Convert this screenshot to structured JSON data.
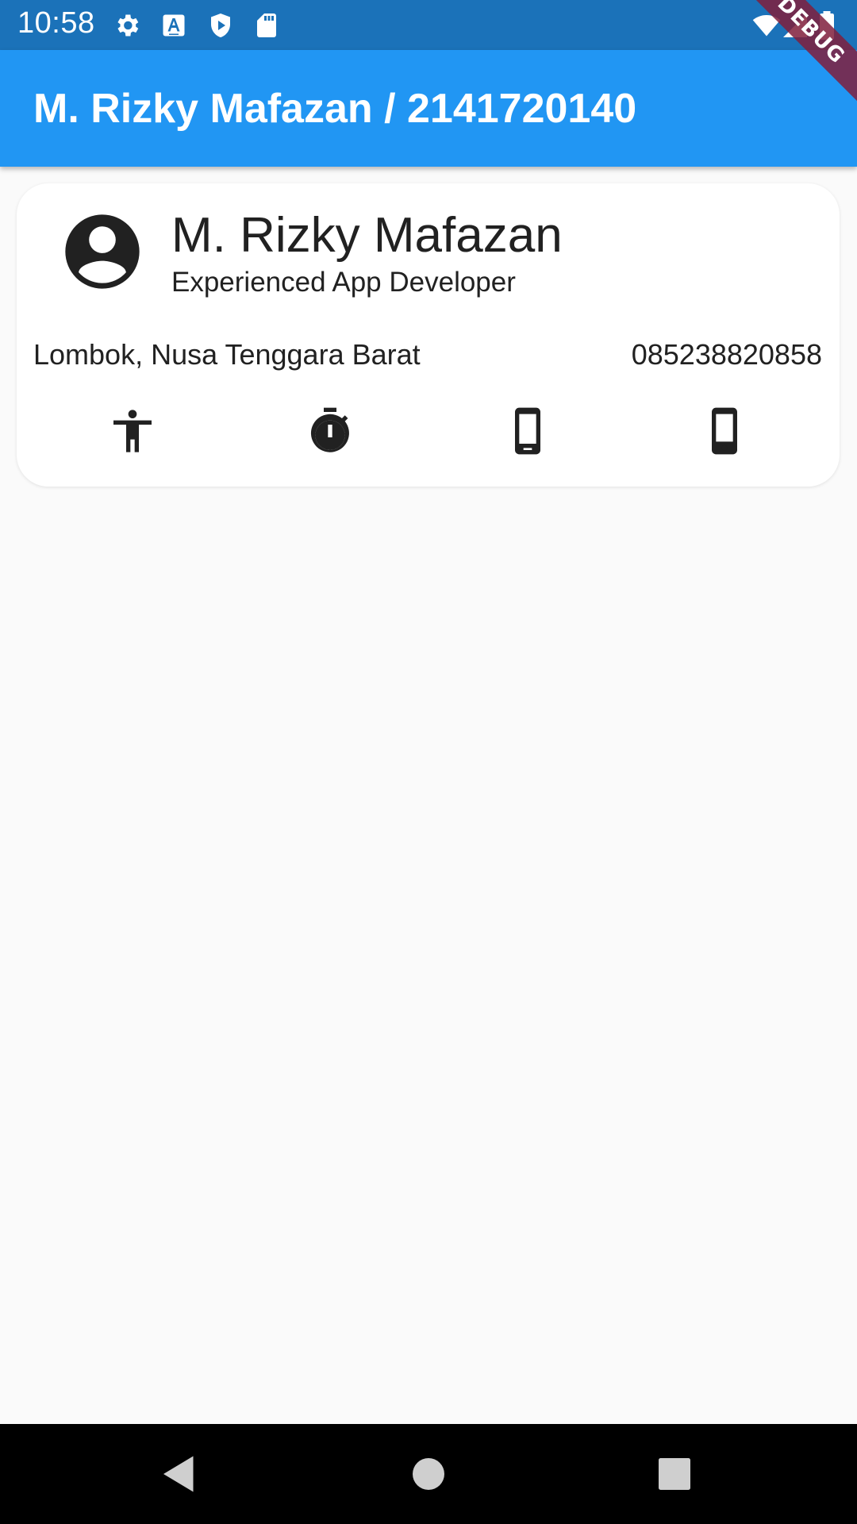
{
  "status_bar": {
    "time": "10:58",
    "left_icons": [
      "gear-icon",
      "font-a-icon",
      "shield-play-icon",
      "sd-card-icon"
    ],
    "right_icons": [
      "wifi-icon",
      "signal-icon",
      "battery-icon"
    ]
  },
  "app_bar": {
    "title": "M. Rizky Mafazan / 2141720140",
    "color": "#2196f3"
  },
  "debug_banner": {
    "label": "DEBUG"
  },
  "profile_card": {
    "avatar_icon": "account-circle-icon",
    "name": "M. Rizky Mafazan",
    "role": "Experienced App Developer",
    "location": "Lombok, Nusa Tenggara Barat",
    "phone": "085238820858",
    "action_icons": [
      "accessibility-icon",
      "timer-icon",
      "smartphone-icon",
      "phone-android-icon"
    ]
  },
  "nav_bar": {
    "buttons": [
      "back-icon",
      "home-icon",
      "recents-icon"
    ]
  }
}
